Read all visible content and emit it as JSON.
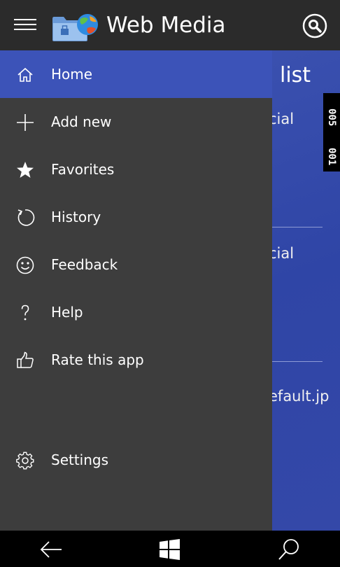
{
  "app": {
    "title": "Web Media",
    "logo_icon": "folder-globe-icon",
    "menu_icon": "hamburger-icon",
    "search_icon": "search-icon"
  },
  "colors": {
    "titlebar": "#2b2b2b",
    "drawer": "#3d3d3d",
    "accent": "#3c53b8",
    "content_background": "#3448a8"
  },
  "drawer": {
    "items": [
      {
        "label": "Home",
        "icon": "home-icon",
        "active": true
      },
      {
        "label": "Add new",
        "icon": "plus-icon",
        "active": false
      },
      {
        "label": "Favorites",
        "icon": "star-icon",
        "active": false
      },
      {
        "label": "History",
        "icon": "refresh-icon",
        "active": false
      },
      {
        "label": "Feedback",
        "icon": "smiley-icon",
        "active": false
      },
      {
        "label": "Help",
        "icon": "question-icon",
        "active": false
      },
      {
        "label": "Rate this app",
        "icon": "thumbs-up-icon",
        "active": false
      }
    ],
    "settings": {
      "label": "Settings",
      "icon": "gear-icon"
    }
  },
  "content": {
    "title_visible": "list",
    "items_visible": [
      "cial",
      "cial",
      "efault.jp"
    ],
    "strip_texts": [
      "005",
      "001"
    ]
  },
  "system_nav": {
    "back_icon": "back-arrow-icon",
    "start_icon": "windows-logo-icon",
    "search_icon": "search-icon"
  }
}
